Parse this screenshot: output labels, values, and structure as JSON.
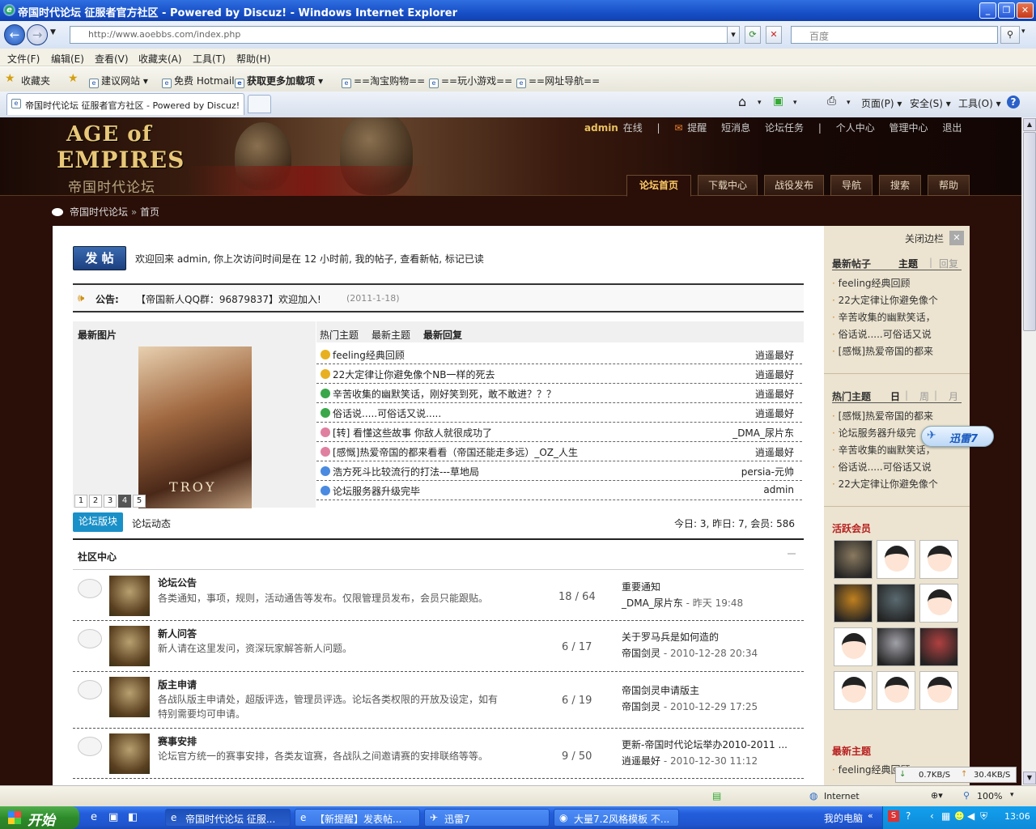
{
  "window": {
    "title": "帝国时代论坛 征服者官方社区 - Powered by Discuz! - Windows Internet Explorer"
  },
  "address": {
    "url": "http://www.aoebbs.com/index.php",
    "search_placeholder": "百度"
  },
  "menu": [
    "文件(F)",
    "编辑(E)",
    "查看(V)",
    "收藏夹(A)",
    "工具(T)",
    "帮助(H)"
  ],
  "favorites": {
    "label": "收藏夹",
    "items": [
      "建议网站 ▾",
      "免费 Hotmail",
      "获取更多加载项 ▾",
      "==淘宝购物==",
      "==玩小游戏==",
      "==网址导航=="
    ]
  },
  "tab": {
    "title": "帝国时代论坛 征服者官方社区 - Powered by Discuz!",
    "tools": [
      "页面(P) ▾",
      "安全(S) ▾",
      "工具(O) ▾"
    ]
  },
  "header": {
    "logo_line1": "AGE of",
    "logo_line2": "EMPIRES",
    "logo_cn": "帝国时代论坛",
    "user": "admin",
    "user_status": "在线",
    "links": [
      "提醒",
      "短消息",
      "论坛任务",
      "个人中心",
      "管理中心",
      "退出"
    ],
    "nav": [
      "论坛首页",
      "下载中心",
      "战役发布",
      "导航",
      "搜索",
      "帮助"
    ]
  },
  "breadcrumb": {
    "site": "帝国时代论坛",
    "sep": "»",
    "current": "首页"
  },
  "welcome": {
    "post_button": "发 帖",
    "text": "欢迎回来 admin, 你上次访问时间是在 12 小时前, 我的帖子, 查看新帖, 标记已读"
  },
  "announce": {
    "label": "公告:",
    "text": "【帝国新人QQ群：96879837】欢迎加入!",
    "date": "(2011-1-18)"
  },
  "latest_image": {
    "title": "最新图片",
    "poster_text": "TROY",
    "pages": [
      "1",
      "2",
      "3",
      "4",
      "5"
    ]
  },
  "topics": {
    "tabs": [
      "热门主题",
      "最新主题",
      "最新回复"
    ],
    "rows": [
      {
        "title": "feeling经典回顾",
        "author": "逍遥最好",
        "color": "#e8b020"
      },
      {
        "title": "22大定律让你避免像个NB一样的死去",
        "author": "逍遥最好",
        "color": "#e8b020"
      },
      {
        "title": "辛苦收集的幽默笑话，刚好笑到死，敢不敢进？？？",
        "author": "逍遥最好",
        "color": "#3aa84a"
      },
      {
        "title": "俗话说.....可俗话又说.....",
        "author": "逍遥最好",
        "color": "#3aa84a"
      },
      {
        "title": "[转] 看懂这些故事  你敌人就很成功了",
        "author": "_DMA_尿片东",
        "color": "#e080a0"
      },
      {
        "title": "[感慨]热爱帝国的都来看看（帝国还能走多远）_OZ_人生",
        "author": "逍遥最好",
        "color": "#e080a0"
      },
      {
        "title": "浩方死斗比较流行的打法---草地局",
        "author": "persia-元帅",
        "color": "#4a8ae0"
      },
      {
        "title": "论坛服务器升级完毕",
        "author": "admin",
        "color": "#4a8ae0"
      }
    ]
  },
  "forum_tabs": {
    "items": [
      "论坛版块",
      "论坛动态"
    ],
    "stats": "今日: 3, 昨日: 7, 会员: 586"
  },
  "community": {
    "title": "社区中心",
    "forums": [
      {
        "name": "论坛公告",
        "desc": "各类通知，事项，规则，活动通告等发布。仅限管理员发布，会员只能跟贴。",
        "count": "18 / 64",
        "last_title": "重要通知",
        "last_user": "_DMA_尿片东",
        "last_time": "- 昨天 19:48"
      },
      {
        "name": "新人问答",
        "desc": "新人请在这里发问，资深玩家解答新人问题。",
        "count": "6 / 17",
        "last_title": "关于罗马兵是如何造的",
        "last_user": "帝国剑灵",
        "last_time": "- 2010-12-28 20:34"
      },
      {
        "name": "版主申请",
        "desc": "各战队版主申请处，超版评选，管理员评选。论坛各类权限的开放及设定，如有特别需要均可申请。",
        "count": "6 / 19",
        "last_title": "帝国剑灵申请版主",
        "last_user": "帝国剑灵",
        "last_time": "- 2010-12-29 17:25"
      },
      {
        "name": "赛事安排",
        "desc": "论坛官方统一的赛事安排，各类友谊赛，各战队之间邀请赛的安排联络等等。",
        "count": "9 / 50",
        "last_title": "更新-帝国时代论坛举办2010-2011 ...",
        "last_user": "逍遥最好",
        "last_time": "- 2010-12-30 11:12"
      }
    ]
  },
  "sidebar": {
    "close_label": "关闭边栏",
    "latest_posts": {
      "title": "最新帖子",
      "tabs": [
        "主题",
        "回复"
      ],
      "items": [
        "feeling经典回顾",
        "22大定律让你避免像个",
        "辛苦收集的幽默笑话，",
        "俗话说.....可俗话又说",
        "[感慨]热爱帝国的都来"
      ]
    },
    "hot": {
      "title": "热门主题",
      "tabs": [
        "日",
        "周",
        "月"
      ],
      "items": [
        "[感慨]热爱帝国的都来",
        "论坛服务器升级完",
        "辛苦收集的幽默笑话，",
        "俗话说.....可俗话又说",
        "22大定律让你避免像个"
      ]
    },
    "active": {
      "title": "活跃会员"
    },
    "latest_topics": {
      "title": "最新主题",
      "items": [
        "feeling经典回顾"
      ]
    }
  },
  "xunlei": {
    "label": "迅雷7",
    "down": "0.7KB/S",
    "up": "30.4KB/S"
  },
  "status": {
    "zone": "Internet",
    "zoom": "100%"
  },
  "taskbar": {
    "start": "开始",
    "tasks": [
      "帝国时代论坛 征服...",
      "【新提醒】发表帖...",
      "迅雷7",
      "大量7.2风格模板 不..."
    ],
    "mycomputer": "我的电脑",
    "time": "13:06"
  }
}
